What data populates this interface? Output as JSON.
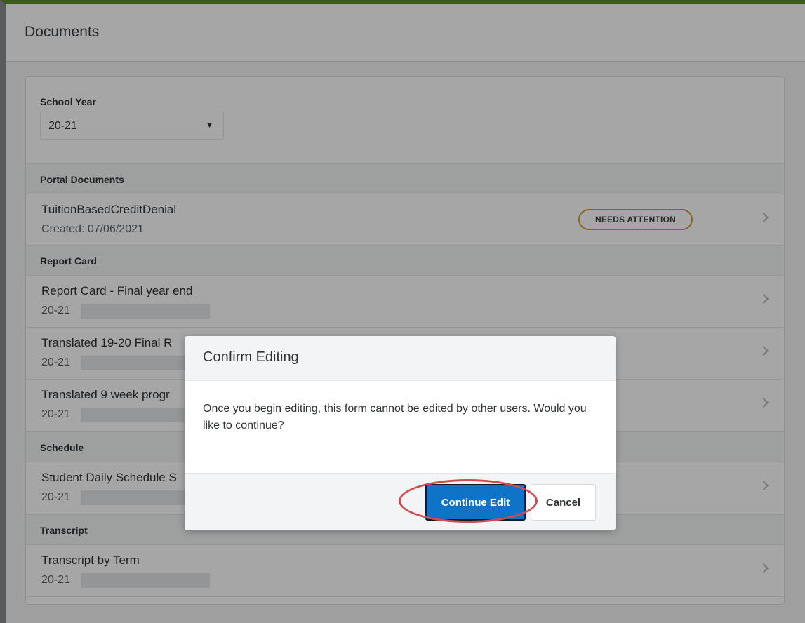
{
  "header": {
    "title": "Documents"
  },
  "school_year": {
    "label": "School Year",
    "value": "20-21"
  },
  "sections": {
    "portal": {
      "label": "Portal Documents",
      "rows": [
        {
          "title": "TuitionBasedCreditDenial",
          "sub": "Created: 07/06/2021",
          "badge": "NEEDS ATTENTION"
        }
      ]
    },
    "report_card": {
      "label": "Report Card",
      "rows": [
        {
          "title": "Report Card - Final year end",
          "sub": "20-21"
        },
        {
          "title": "Translated 19-20 Final R",
          "sub": "20-21"
        },
        {
          "title": "Translated 9 week progr",
          "sub": "20-21"
        }
      ]
    },
    "schedule": {
      "label": "Schedule",
      "rows": [
        {
          "title": "Student Daily Schedule S",
          "sub": "20-21"
        }
      ]
    },
    "transcript": {
      "label": "Transcript",
      "rows": [
        {
          "title": "Transcript by Term",
          "sub": "20-21"
        }
      ]
    }
  },
  "modal": {
    "title": "Confirm Editing",
    "body": "Once you begin editing, this form cannot be edited by other users. Would you like to continue?",
    "continue_label": "Continue Edit",
    "cancel_label": "Cancel"
  },
  "colors": {
    "primary_button": "#0f74c7",
    "badge_border": "#c9a227",
    "highlight_ring": "#d24a4f",
    "top_accent": "#5b8c2a"
  }
}
